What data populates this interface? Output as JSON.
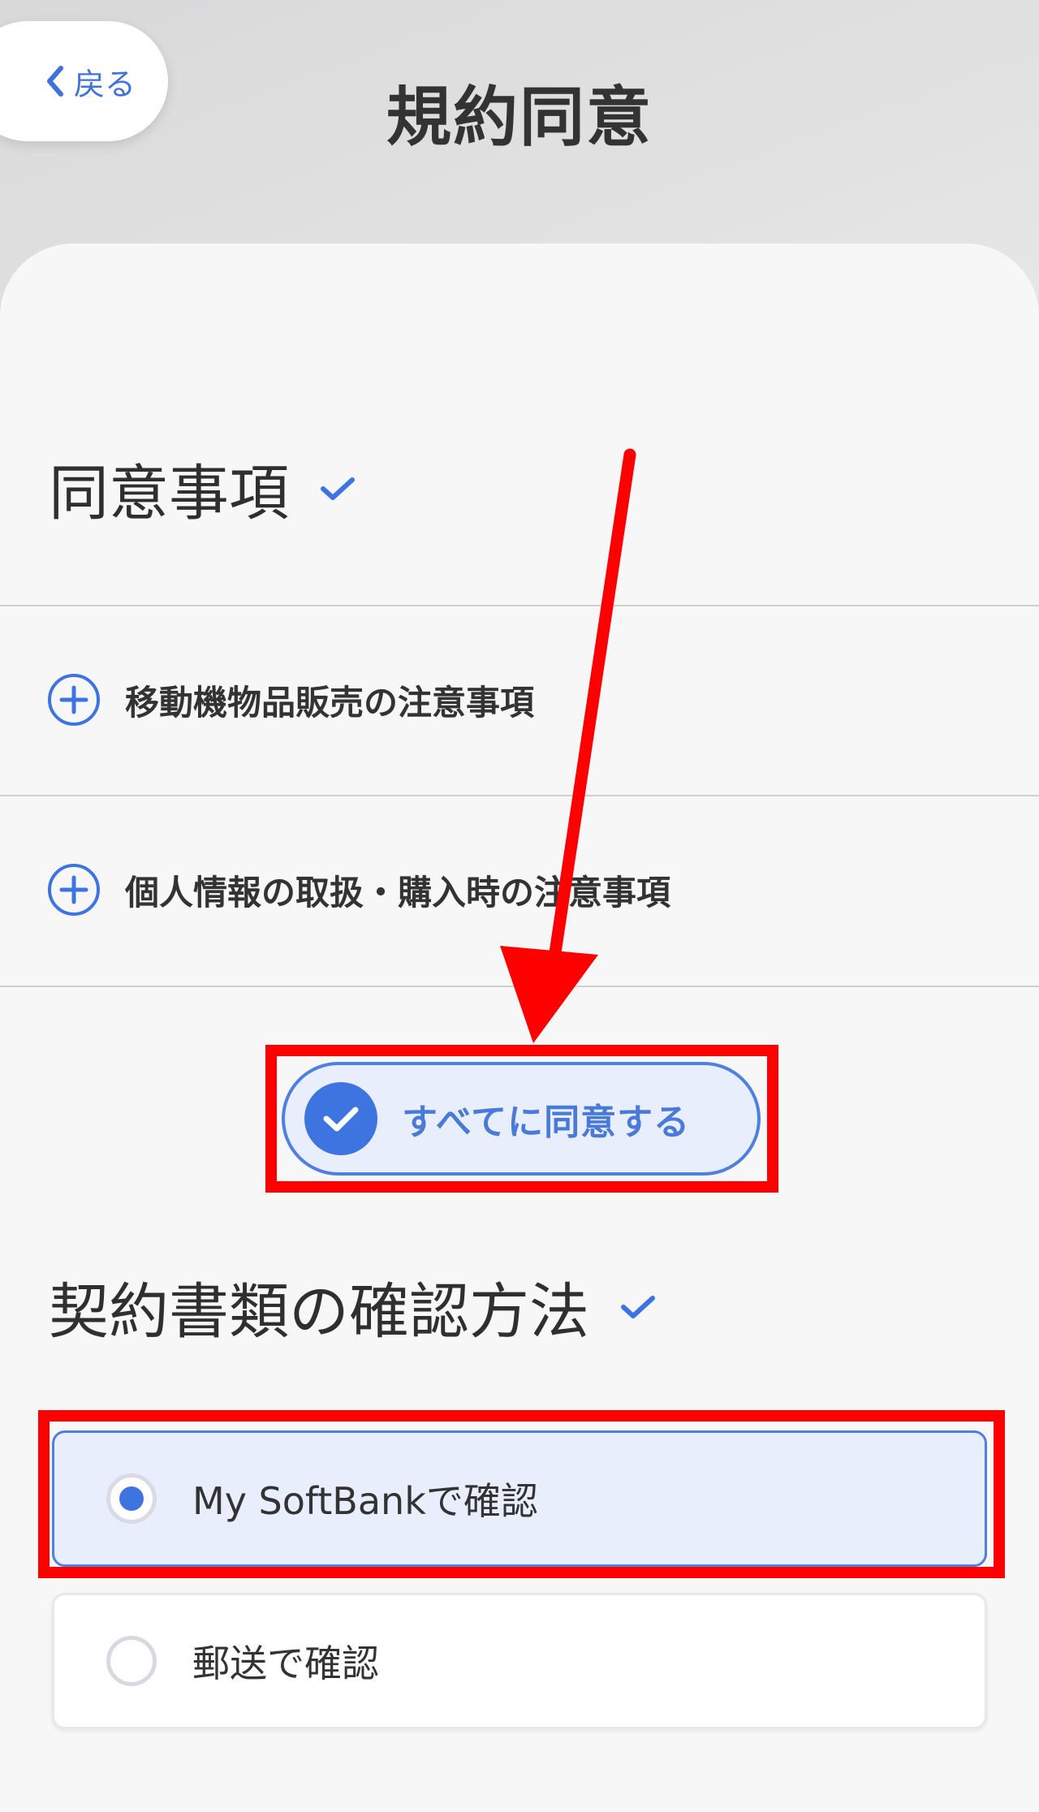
{
  "header": {
    "back_label": "戻る",
    "title": "規約同意"
  },
  "consent": {
    "title": "同意事項",
    "items": [
      {
        "label": "移動機物品販売の注意事項"
      },
      {
        "label": "個人情報の取扱・購入時の注意事項"
      }
    ],
    "agree_all_label": "すべてに同意する"
  },
  "documents": {
    "title": "契約書類の確認方法",
    "options": [
      {
        "label": "My SoftBankで確認",
        "selected": true
      },
      {
        "label": "郵送で確認",
        "selected": false
      }
    ]
  },
  "colors": {
    "accent": "#3e74e0",
    "annotation": "#ff0000",
    "text": "#333333"
  },
  "icons": [
    "chevron-left-icon",
    "check-icon",
    "plus-circle-icon",
    "radio-icon",
    "arrow-annotation"
  ]
}
